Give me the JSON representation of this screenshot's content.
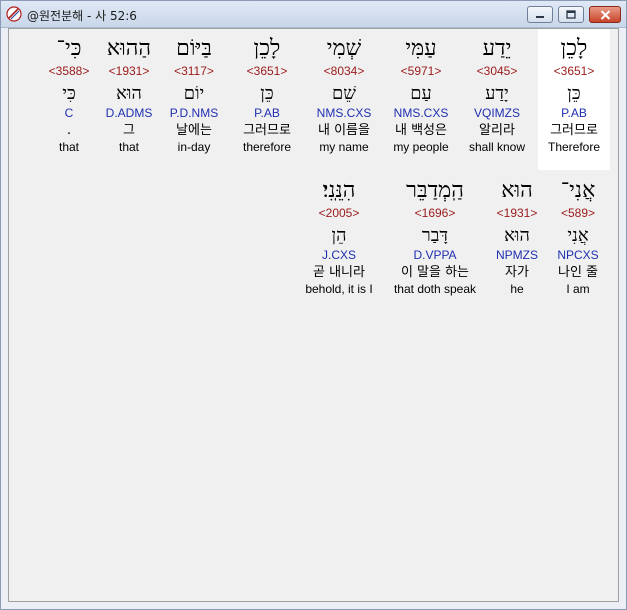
{
  "window": {
    "title": "@원전분해 - 사 52:6",
    "icon": "hebrew-bible-app-icon",
    "buttons": [
      "minimize-icon",
      "maximize-icon",
      "close-icon"
    ]
  },
  "row1": [
    {
      "hebrew": "לָכֵן",
      "strong": "<3651>",
      "lemma": "כֵּן",
      "morph": "P.AB",
      "korean": "그러므로",
      "english": "Therefore"
    },
    {
      "hebrew": "יֵדַע",
      "strong": "<3045>",
      "lemma": "יָדַע",
      "morph": "VQIMZS",
      "korean": "알리라",
      "english": "shall know"
    },
    {
      "hebrew": "עַמִּי",
      "strong": "<5971>",
      "lemma": "עַם",
      "morph": "NMS.CXS",
      "korean": "내 백성은",
      "english": "my people"
    },
    {
      "hebrew": "שְׁמִי",
      "strong": "<8034>",
      "lemma": "שֵׁם",
      "morph": "NMS.CXS",
      "korean": "내 이름을",
      "english": "my name"
    },
    {
      "hebrew": "לָכֵן",
      "strong": "<3651>",
      "lemma": "כֵּן",
      "morph": "P.AB",
      "korean": "그러므로",
      "english": "therefore"
    },
    {
      "hebrew": "בַּיּוֹם",
      "strong": "<3117>",
      "lemma": "יוֹם",
      "morph": "P.D.NMS",
      "korean": "날에는",
      "english": "in-day"
    },
    {
      "hebrew": "הַהוּא",
      "strong": "<1931>",
      "lemma": "הוּא",
      "morph": "D.ADMS",
      "korean": "그",
      "english": "that"
    },
    {
      "hebrew": "כִּי־",
      "strong": "<3588>",
      "lemma": "כִּי",
      "morph": "C",
      "korean": ".",
      "english": "that"
    }
  ],
  "row2": [
    {
      "hebrew": "אֲנִי־",
      "strong": "<589>",
      "lemma": "אֲנִי",
      "morph": "NPCXS",
      "korean": "나인 줄",
      "english": "I am"
    },
    {
      "hebrew": "הוּא",
      "strong": "<1931>",
      "lemma": "הוּא",
      "morph": "NPMZS",
      "korean": "자가",
      "english": "he"
    },
    {
      "hebrew": "הַֽמְדַבֵּר",
      "strong": "<1696>",
      "lemma": "דָּבַר",
      "morph": "D.VPPA",
      "korean": "이 말을 하는",
      "english": "that doth speak"
    },
    {
      "hebrew": "הִנֵּֽנִי׃",
      "strong": "<2005>",
      "lemma": "הֵן",
      "morph": "J.CXS",
      "korean": "곧 내니라",
      "english": "behold, it is I"
    }
  ]
}
